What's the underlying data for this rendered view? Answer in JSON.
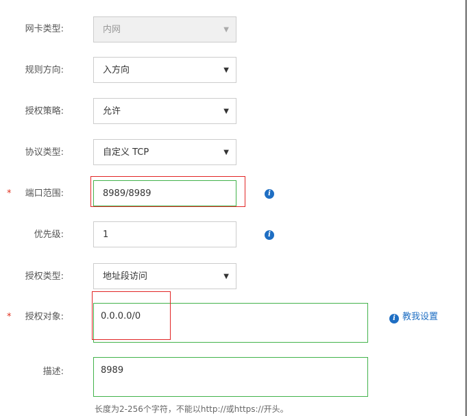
{
  "form": {
    "nic_type": {
      "label": "网卡类型:",
      "value": "内网",
      "disabled": true
    },
    "direction": {
      "label": "规则方向:",
      "value": "入方向"
    },
    "policy": {
      "label": "授权策略:",
      "value": "允许"
    },
    "protocol": {
      "label": "协议类型:",
      "value": "自定义 TCP"
    },
    "port_range": {
      "label": "端口范围:",
      "value": "8989/8989",
      "required": true,
      "required_mark": "*"
    },
    "priority": {
      "label": "优先级:",
      "value": "1"
    },
    "auth_type": {
      "label": "授权类型:",
      "value": "地址段访问"
    },
    "auth_object": {
      "label": "授权对象:",
      "value": "0.0.0.0/0",
      "required": true,
      "required_mark": "*",
      "help_link": "教我设置"
    },
    "description": {
      "label": "描述:",
      "value": "8989",
      "hint": "长度为2-256个字符，不能以http://或https://开头。"
    }
  },
  "icons": {
    "info": "i",
    "dropdown": "▼"
  },
  "colors": {
    "accent": "#1e6ec3",
    "required": "#e0301e",
    "focus": "#41b24a",
    "highlight": "#e12424"
  }
}
